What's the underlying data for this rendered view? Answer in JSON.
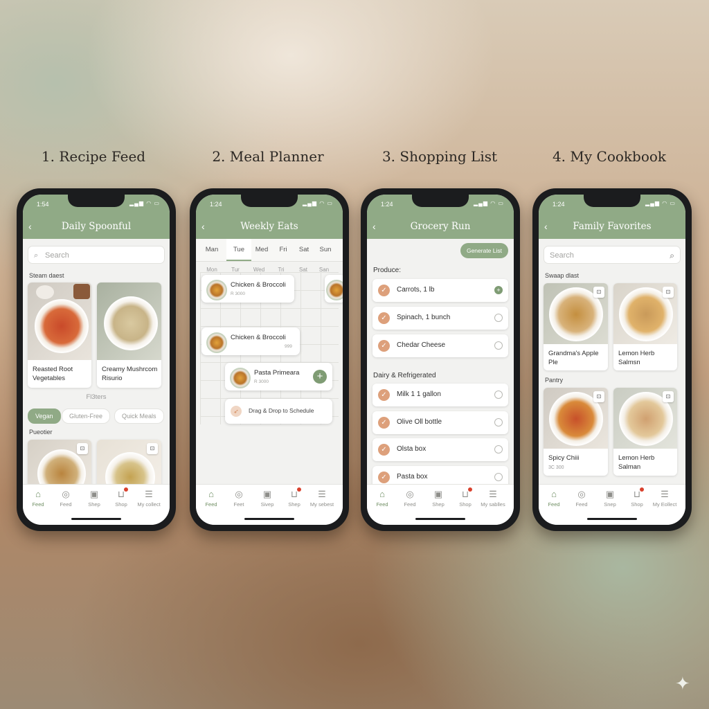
{
  "sections": [
    {
      "title": "1. Recipe Feed"
    },
    {
      "title": "2. Meal Planner"
    },
    {
      "title": "3. Shopping List"
    },
    {
      "title": "4. My Cookbook"
    }
  ],
  "colors": {
    "accent": "#90aa86",
    "check": "#dda07b",
    "badge": "#d9412d"
  },
  "feed": {
    "time": "1:54",
    "title": "Daily Spoonful",
    "search_placeholder": "Search",
    "section1": "Steam daest",
    "cards": [
      {
        "caption": "Reasted Root Vegetables"
      },
      {
        "caption": "Creamy Mushrcom Risurio"
      }
    ],
    "filters_label": "Fl3ters",
    "filters": [
      "Vegan",
      "Gluten-Free",
      "Quick Meals"
    ],
    "section2": "Pueotier"
  },
  "planner": {
    "time": "1:24",
    "title": "Weekly Eats",
    "days": [
      "Man",
      "Tue",
      "Med",
      "Fri",
      "Sat",
      "Sun"
    ],
    "grid_days": [
      "Mon",
      "Tur",
      "Wed",
      "Tri",
      "Sat",
      "San"
    ],
    "meals": [
      {
        "name": "Chicken & Broccoli",
        "sub": "R 3000"
      },
      {
        "name": "Chicken & Broccoli",
        "sub": "999"
      },
      {
        "name": "Pasta Primeara",
        "sub": "R 3000"
      }
    ],
    "drag_hint": "Drag & Drop to Schedule"
  },
  "shopping": {
    "time": "1:24",
    "title": "Grocery Run",
    "generate": "Generate List",
    "produce_label": "Produce:",
    "produce": [
      "Carrots, 1 lb",
      "Spinach, 1 bunch",
      "Chedar Cheese"
    ],
    "dairy_label": "Dairy & Refrigerated",
    "dairy": [
      "Milk 1 1 gallon",
      "Olive Oll bottle",
      "Olsta box",
      "Pasta box"
    ]
  },
  "cookbook": {
    "time": "1:24",
    "title": "Family Favorites",
    "search_placeholder": "Search",
    "section1": "Swaap dlast",
    "cards1": [
      {
        "caption": "Grandma's Apple Ple"
      },
      {
        "caption": "Lemon Herb Salmsn"
      }
    ],
    "section2": "Pantry",
    "cards2": [
      {
        "caption": "Spicy Chiii",
        "sub": "3C 300"
      },
      {
        "caption": "Lemon Herb Salman"
      }
    ]
  },
  "tabs": {
    "feed": [
      "Feed",
      "Feed",
      "Shep",
      "Shop",
      "My collect"
    ],
    "planner": [
      "Feed",
      "Feet",
      "Sivep",
      "Shep",
      "My sebest"
    ],
    "shopping": [
      "Feed",
      "Feed",
      "Shep",
      "Shop",
      "My sablles"
    ],
    "cookbook": [
      "Feed",
      "Feed",
      "Snep",
      "Shop",
      "My Eollect"
    ]
  }
}
